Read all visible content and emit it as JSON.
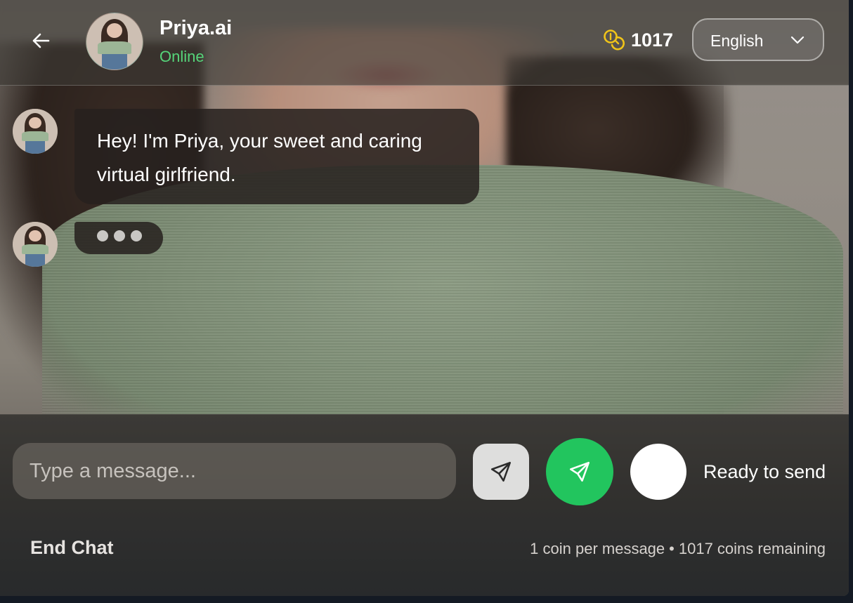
{
  "header": {
    "name": "Priya.ai",
    "status": "Online",
    "coin_count": "1017",
    "language": "English"
  },
  "messages": [
    {
      "sender": "bot",
      "text": "Hey! I'm Priya, your sweet and caring virtual girlfriend."
    }
  ],
  "typing_indicator": true,
  "composer": {
    "placeholder": "Type a message...",
    "value": "",
    "ready_label": "Ready to send",
    "end_chat_label": "End Chat",
    "cost_text": "1 coin per message",
    "separator": "•",
    "remaining_text": "1017 coins remaining"
  },
  "colors": {
    "online": "#56d47a",
    "send_active": "#22c55e",
    "coin": "#f0c419"
  },
  "icons": {
    "back": "arrow-left-icon",
    "coin": "coins-icon",
    "dropdown": "chevron-down-icon",
    "send": "send-icon"
  }
}
